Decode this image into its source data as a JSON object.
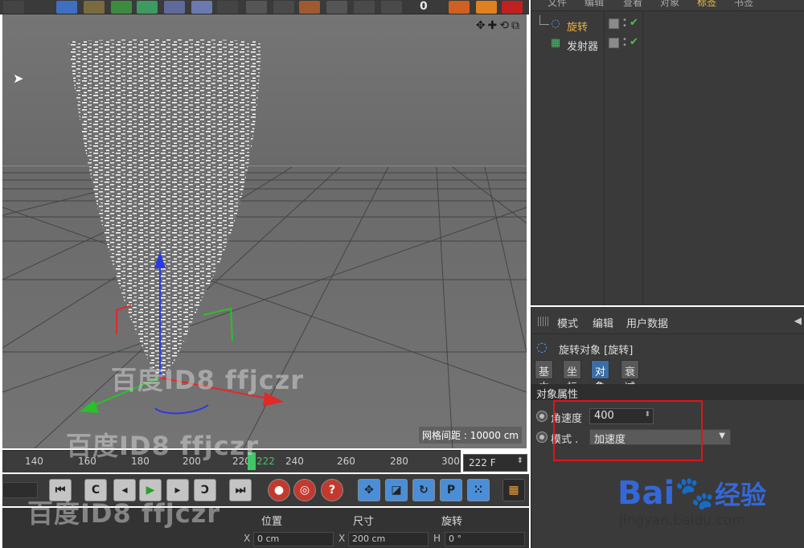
{
  "toolbar": {
    "counter": "0"
  },
  "viewport": {
    "nav_icons": "✥✚⟲⧉",
    "grid_spacing_label": "网格间距 : 10000 cm"
  },
  "timeline": {
    "ticks": [
      "140",
      "160",
      "180",
      "200",
      "220",
      "222",
      "240",
      "260",
      "280",
      "300"
    ],
    "current_frame": "222 F"
  },
  "coords": {
    "headers": [
      "位置",
      "尺寸",
      "旋转"
    ],
    "axes": [
      "X",
      "X",
      "H"
    ],
    "values": [
      "0 cm",
      "200 cm",
      "0 °"
    ]
  },
  "object_manager": {
    "menu": [
      "文件",
      "编辑",
      "查看",
      "对象",
      "标签",
      "书签"
    ],
    "objects": [
      {
        "name": "旋转",
        "icon": "rotate-icon",
        "color": "#f0b040"
      },
      {
        "name": "发射器",
        "icon": "emitter-icon",
        "color": "#dcdcdc"
      }
    ]
  },
  "attribute_manager": {
    "menu": [
      "模式",
      "编辑",
      "用户数据"
    ],
    "title": "旋转对象 [旋转]",
    "tabs": [
      "基本",
      "坐标",
      "对象",
      "衰减"
    ],
    "active_tab": "对象",
    "section": "对象属性",
    "fields": {
      "angular_speed_label": "角速度",
      "angular_speed_value": "400",
      "mode_label": "模式 .",
      "mode_value": "加速度"
    }
  },
  "watermarks": {
    "user": "百度ID8 ffjczr",
    "brand": "Bai",
    "brand_cn": "经验",
    "url": "jingyan.baidu.com"
  },
  "colors": {
    "accent_blue": "#3b6ea5",
    "highlight_red": "#e0141a",
    "playhead_green": "#3fc76a"
  }
}
